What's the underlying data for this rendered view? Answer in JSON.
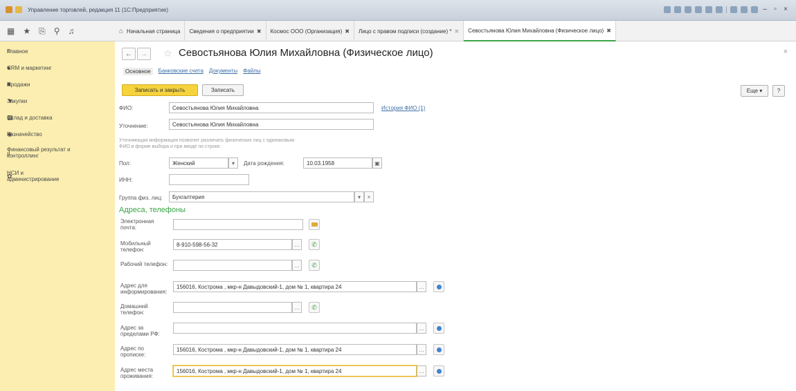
{
  "window": {
    "title": "Управление торговлей, редакция 11 (1С:Предприятие)"
  },
  "tabs": [
    {
      "label": "Начальная страница",
      "closable": false
    },
    {
      "label": "Сведения о предприятии",
      "closable": true
    },
    {
      "label": "Космос ООО (Организация)",
      "closable": true
    },
    {
      "label": "Лицо с правом подписи (создание) *",
      "closable": true
    },
    {
      "label": "Севостьянова Юлия Михайловна (Физическое лицо)",
      "closable": true,
      "active": true
    }
  ],
  "sidebar": {
    "items": [
      {
        "label": "Главное",
        "icon": "menu-icon"
      },
      {
        "label": "CRM и маркетинг",
        "icon": "crm-icon"
      },
      {
        "label": "Продажи",
        "icon": "bag-icon"
      },
      {
        "label": "Закупки",
        "icon": "cart-icon"
      },
      {
        "label": "Склад и доставка",
        "icon": "warehouse-icon"
      },
      {
        "label": "Казначейство",
        "icon": "coins-icon"
      },
      {
        "label": "Финансовый результат и контроллинг",
        "icon": "chart-icon"
      },
      {
        "label": "НСИ и администрирование",
        "icon": "gear-icon"
      }
    ]
  },
  "form": {
    "title": "Севостьянова Юлия Михайловна (Физическое лицо)",
    "subtabs": [
      "Основное",
      "Банковские счета",
      "Документы",
      "Файлы"
    ],
    "buttons": {
      "save_close": "Записать и закрыть",
      "save": "Записать",
      "more": "Еще",
      "help": "?"
    },
    "fio_label": "ФИО:",
    "fio_value": "Севостьянова Юлия Михайловна",
    "fio_history": "История ФИО (1)",
    "clarify_label": "Уточнение:",
    "clarify_value": "Севостьянова Юлия Михайловна",
    "hint": "Уточняющая информация позволит различать физических лиц с одинаковым ФИО в форме выбора и при вводе по строке.",
    "gender_label": "Пол:",
    "gender_value": "Женский",
    "birth_label": "Дата рождения:",
    "birth_value": "10.03.1958",
    "inn_label": "ИНН:",
    "inn_value": "",
    "group_label": "Группа физ. лиц:",
    "group_value": "Бухгалтерия",
    "contacts_title": "Адреса, телефоны",
    "contacts": [
      {
        "label": "Электронная почта:",
        "value": "",
        "icon": "mail-icon"
      },
      {
        "label": "Мобильный телефон:",
        "value": "8-910-598-56-32",
        "icon": "phone-icon"
      },
      {
        "label": "Рабочий телефон:",
        "value": "",
        "icon": "phone-icon"
      },
      {
        "label": "Адрес для информирования:",
        "value": "156016, Кострома , мкр-н Давыдовский-1, дом № 1, квартира 24",
        "icon": "map-pin-icon"
      },
      {
        "label": "Домашний телефон:",
        "value": "",
        "icon": "phone-icon"
      },
      {
        "label": "Адрес за пределами РФ:",
        "value": "",
        "icon": "map-pin-icon"
      },
      {
        "label": "Адрес по прописке:",
        "value": "156016, Кострома , мкр-н Давыдовский-1, дом № 1, квартира 24",
        "icon": "map-pin-icon"
      },
      {
        "label": "Адрес места проживания:",
        "value": "156016, Кострома , мкр-н Давыдовский-1, дом № 1, квартира 24",
        "icon": "map-pin-icon"
      }
    ]
  },
  "colors": {
    "sidebar_bg": "#fbeeb0",
    "primary_button": "#f6d33c",
    "accent_green": "#3ba447",
    "link_blue": "#3b6ea5"
  }
}
